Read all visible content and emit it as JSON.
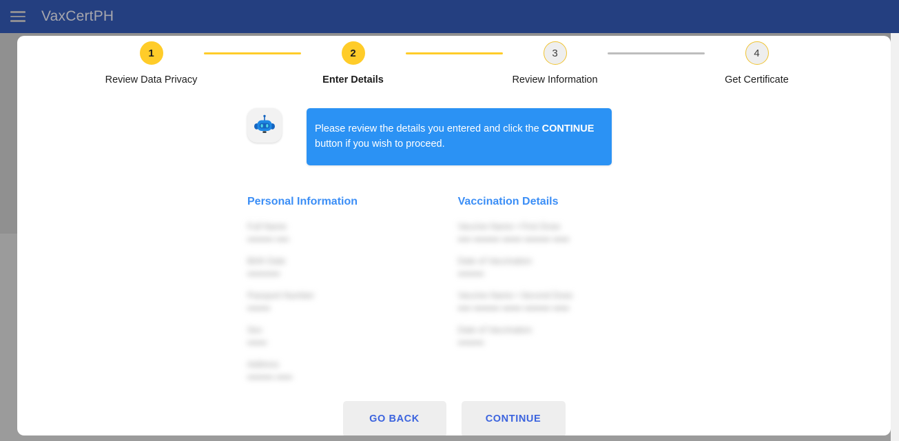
{
  "appbar": {
    "menu_icon": "hamburger-menu-icon",
    "title": "VaxCertPH"
  },
  "colors": {
    "appbar_bg": "#243f80",
    "step_active": "#ffcc29",
    "step_inactive": "#eeeeee",
    "chat_bubble": "#2b92f4",
    "section_title": "#3b8ef6",
    "button_text": "#3b63de",
    "button_bg": "#eeeeee"
  },
  "stepper": {
    "steps": [
      {
        "number": "1",
        "label": "Review Data Privacy",
        "state": "complete"
      },
      {
        "number": "2",
        "label": "Enter Details",
        "state": "current"
      },
      {
        "number": "3",
        "label": "Review Information",
        "state": "inactive"
      },
      {
        "number": "4",
        "label": "Get Certificate",
        "state": "inactive"
      }
    ]
  },
  "chat": {
    "avatar_icon": "robot-bot-icon",
    "message_part1": "Please review the details you entered and click the ",
    "message_emphasis": "CONTINUE",
    "message_part2": " button if you wish to proceed."
  },
  "details": {
    "personal": {
      "title": "Personal Information",
      "fields": [
        {
          "label": "Full Name",
          "value": "•••••••• ••••"
        },
        {
          "label": "Birth Date",
          "value": "••••••••••"
        },
        {
          "label": "Passport Number",
          "value": "•••••••"
        },
        {
          "label": "Sex",
          "value": "••••••"
        },
        {
          "label": "Address",
          "value": "•••••••• •••••"
        }
      ]
    },
    "vaccination": {
      "title": "Vaccination Details",
      "fields": [
        {
          "label": "Vaccine Name • First Dose",
          "value": "•••• •••••••• •••••• •••••••• •••••"
        },
        {
          "label": "Date of Vaccination",
          "value": "••••••••"
        },
        {
          "label": "Vaccine Name • Second Dose",
          "value": "•••• •••••••• •••••• •••••••• •••••"
        },
        {
          "label": "Date of Vaccination",
          "value": "••••••••"
        }
      ]
    }
  },
  "actions": {
    "go_back": "GO BACK",
    "continue": "CONTINUE"
  }
}
